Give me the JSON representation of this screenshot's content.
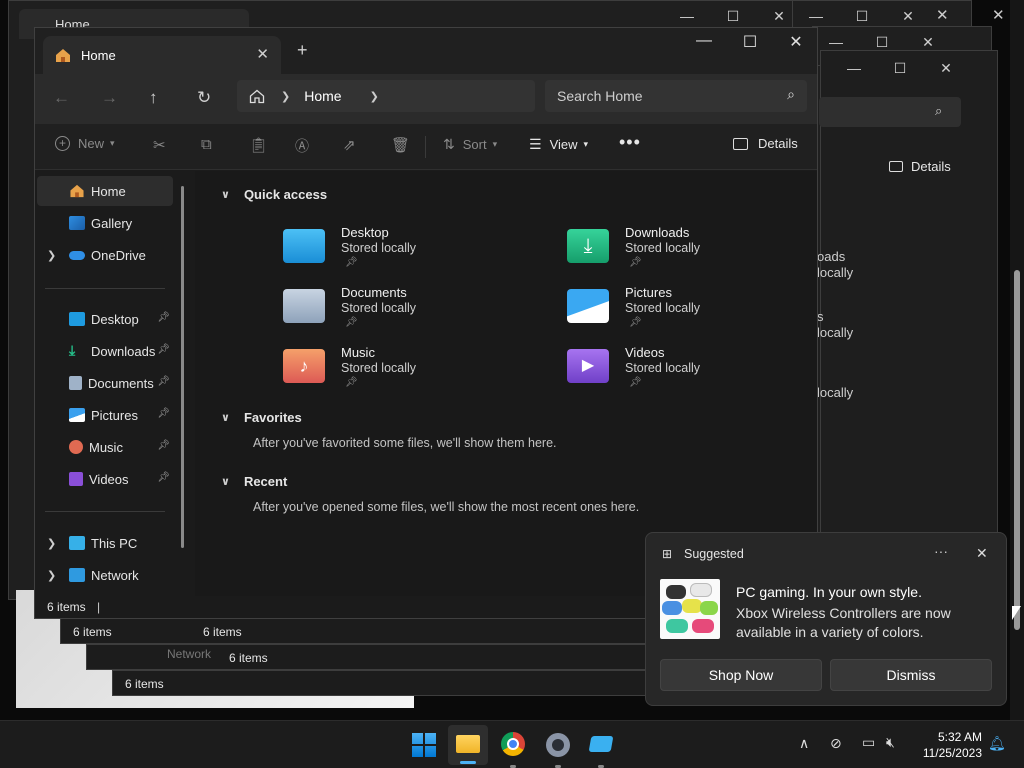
{
  "main": {
    "tab_title": "Home",
    "address": "Home",
    "search_placeholder": "Search Home",
    "commands": {
      "new": "New",
      "sort": "Sort",
      "view": "View",
      "details": "Details"
    },
    "sidebar": {
      "top": [
        {
          "label": "Home"
        },
        {
          "label": "Gallery"
        },
        {
          "label": "OneDrive"
        }
      ],
      "pinned": [
        {
          "label": "Desktop"
        },
        {
          "label": "Downloads"
        },
        {
          "label": "Documents"
        },
        {
          "label": "Pictures"
        },
        {
          "label": "Music"
        },
        {
          "label": "Videos"
        }
      ],
      "bottom": [
        {
          "label": "This PC"
        },
        {
          "label": "Network"
        }
      ]
    },
    "quick_access": {
      "title": "Quick access",
      "folders": [
        {
          "name": "Desktop",
          "status": "Stored locally"
        },
        {
          "name": "Downloads",
          "status": "Stored locally"
        },
        {
          "name": "Documents",
          "status": "Stored locally"
        },
        {
          "name": "Pictures",
          "status": "Stored locally"
        },
        {
          "name": "Music",
          "status": "Stored locally"
        },
        {
          "name": "Videos",
          "status": "Stored locally"
        }
      ]
    },
    "favorites": {
      "title": "Favorites",
      "empty": "After you've favorited some files, we'll show them here."
    },
    "recent": {
      "title": "Recent",
      "empty": "After you've opened some files, we'll show the most recent ones here."
    },
    "status": "6 items"
  },
  "background": {
    "tab_title": "Home",
    "details": "Details",
    "status": "6 items",
    "network": "Network",
    "partial": [
      "oads",
      "locally",
      "s",
      "locally",
      "locally"
    ]
  },
  "toast": {
    "header": "Suggested",
    "title": "PC gaming. In your own style.",
    "body": "Xbox Wireless Controllers are now available in a variety of colors.",
    "primary": "Shop Now",
    "secondary": "Dismiss"
  },
  "taskbar": {
    "time": "5:32 AM",
    "date": "11/25/2023"
  },
  "colors": {
    "accent": "#0078d4",
    "desktop_folder": "#1e9be0",
    "downloads_folder": "#20b07a",
    "music_folder": "#e06a52",
    "videos_folder": "#8a4fd8"
  }
}
